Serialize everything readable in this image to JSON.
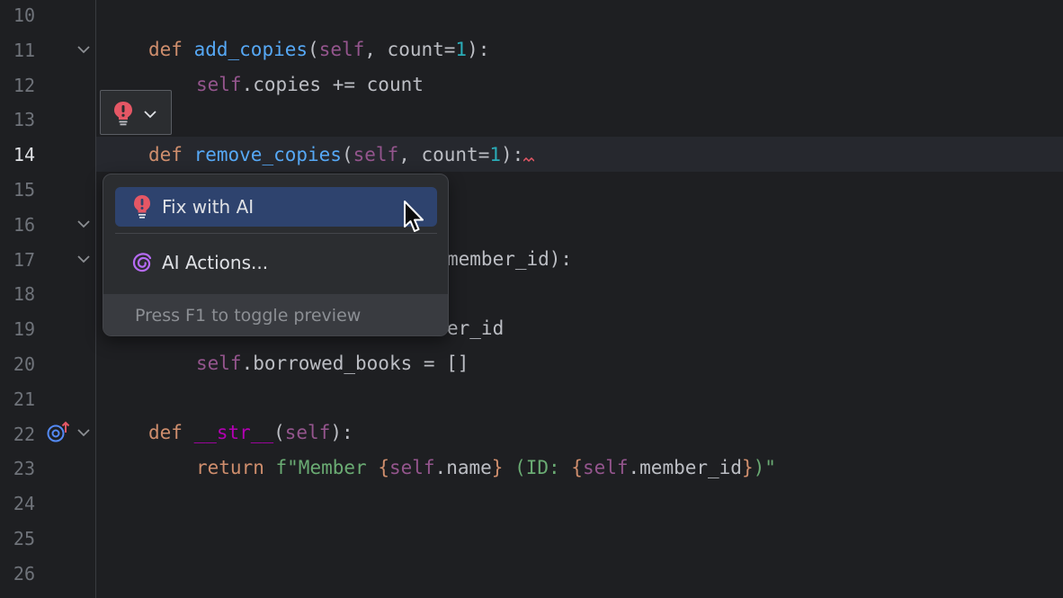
{
  "editor": {
    "current_line": "14",
    "lines": [
      {
        "number": "10"
      },
      {
        "number": "11"
      },
      {
        "number": "12"
      },
      {
        "number": "13"
      },
      {
        "number": "14"
      },
      {
        "number": "15"
      },
      {
        "number": "16"
      },
      {
        "number": "17"
      },
      {
        "number": "18"
      },
      {
        "number": "19"
      },
      {
        "number": "20"
      },
      {
        "number": "21"
      },
      {
        "number": "22"
      },
      {
        "number": "23"
      },
      {
        "number": "24"
      },
      {
        "number": "25"
      },
      {
        "number": "26"
      }
    ],
    "code": {
      "l11": {
        "kw": "def",
        "fn": "add_copies",
        "open": "(",
        "self": "self",
        "mid": ", count=",
        "num": "1",
        "close": "):"
      },
      "l12": {
        "self": "self",
        "rest": ".copies += count"
      },
      "l14": {
        "kw": "def",
        "fn": "remove_copies",
        "open": "(",
        "self": "self",
        "mid": ", count=",
        "num": "1",
        "close": "):"
      },
      "l17": {
        "rest": "member_id):"
      },
      "l19": {
        "rest": "er_id"
      },
      "l20": {
        "self": "self",
        "rest": ".borrowed_books = []"
      },
      "l22": {
        "kw": "def",
        "fn": "__str__",
        "open": "(",
        "self": "self",
        "close": "):"
      },
      "l23": {
        "kw": "return",
        "str1": "f\"Member ",
        "b1": "{",
        "self1": "self",
        "rest1": ".name",
        "b2": "}",
        "str2": " (ID: ",
        "b3": "{",
        "self2": "self",
        "rest2": ".member_id",
        "b4": "}",
        "str3": ")\""
      }
    }
  },
  "popup": {
    "items": [
      {
        "label": "Fix with AI",
        "icon": "red-bulb-icon",
        "selected": true
      },
      {
        "label": "AI Actions...",
        "icon": "ai-spiral-icon",
        "selected": false
      }
    ],
    "footer": "Press F1 to toggle preview"
  },
  "colors": {
    "background": "#1e1f22",
    "keyword": "#cf8e6d",
    "function": "#56a8f5",
    "self": "#94558d",
    "number": "#2aacb8",
    "string": "#6aab73",
    "selection": "#2e436e",
    "error_bulb": "#e55765"
  }
}
